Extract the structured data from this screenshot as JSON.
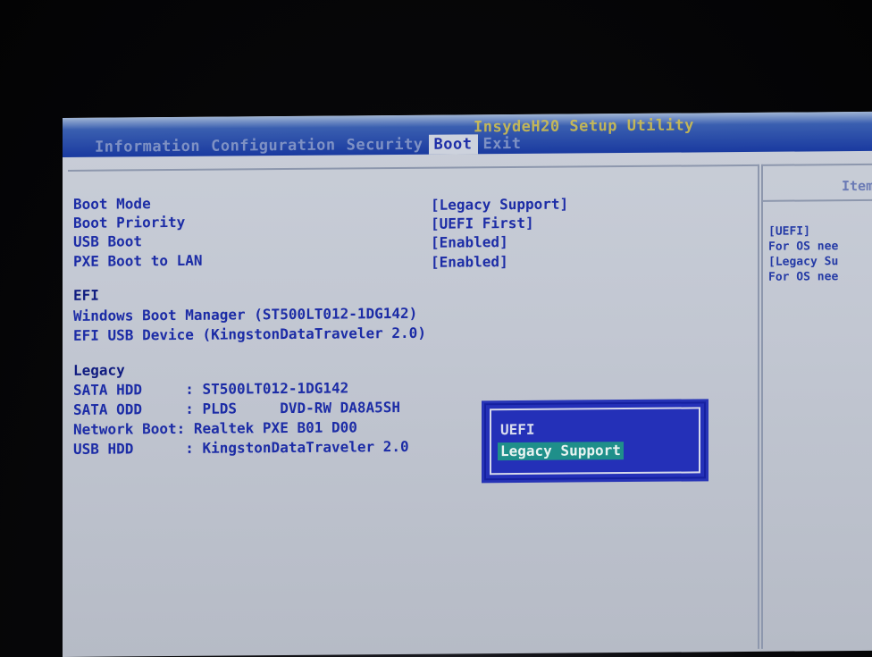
{
  "bios": {
    "utility_title": "InsydeH20 Setup Utility",
    "tabs": [
      {
        "label": "Information",
        "active": false
      },
      {
        "label": "Configuration",
        "active": false
      },
      {
        "label": "Security",
        "active": false
      },
      {
        "label": "Boot",
        "active": true
      },
      {
        "label": "Exit",
        "active": false
      }
    ],
    "settings": [
      {
        "label": "Boot Mode",
        "value": "[Legacy Support]"
      },
      {
        "label": "Boot Priority",
        "value": "[UEFI First]"
      },
      {
        "label": "USB Boot",
        "value": "[Enabled]"
      },
      {
        "label": "PXE Boot to LAN",
        "value": "[Enabled]"
      }
    ],
    "efi": {
      "heading": "EFI",
      "items": [
        "Windows Boot Manager (ST500LT012-1DG142)",
        "EFI USB Device (KingstonDataTraveler 2.0)"
      ]
    },
    "legacy": {
      "heading": "Legacy",
      "items": [
        "SATA HDD     : ST500LT012-1DG142",
        "SATA ODD     : PLDS     DVD-RW DA8A5SH",
        "Network Boot: Realtek PXE B01 D00",
        "USB HDD      : KingstonDataTraveler 2.0"
      ]
    },
    "popup": {
      "options": [
        "UEFI",
        "Legacy Support"
      ],
      "selected": "Legacy Support"
    },
    "help": {
      "title": "Item",
      "lines": [
        "[UEFI]",
        "For OS nee",
        "[Legacy Su",
        "For OS nee"
      ]
    },
    "colors": {
      "screen_bg": "#c9ced8",
      "text_blue": "#1c2ca6",
      "title_bar": "#1a3aa0",
      "popup_bg": "#2430b8",
      "selection": "#1f8f8a"
    }
  }
}
